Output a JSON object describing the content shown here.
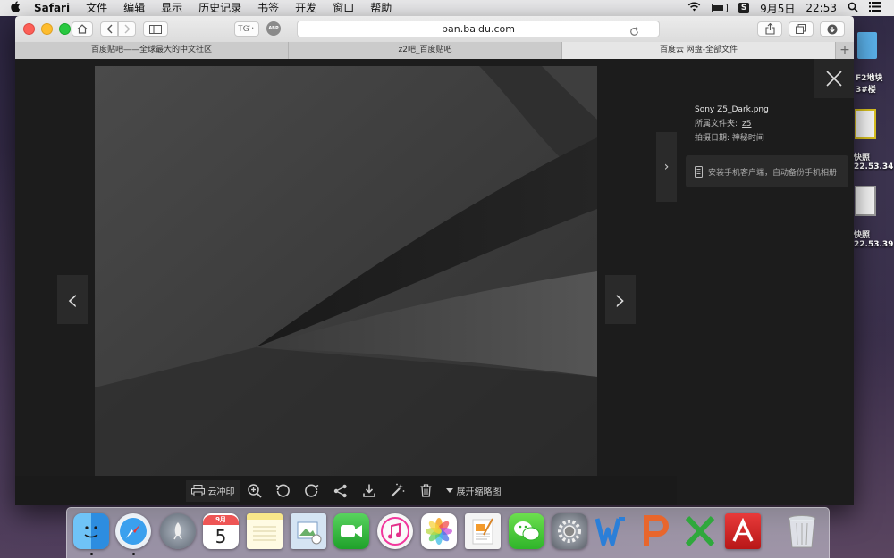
{
  "menubar": {
    "apple": "",
    "items": [
      "Safari",
      "文件",
      "编辑",
      "显示",
      "历史记录",
      "书签",
      "开发",
      "窗口",
      "帮助"
    ],
    "s_badge": "S",
    "date": "9月5日",
    "time": "22:53"
  },
  "desktop_icons": [
    {
      "line1": "F2地块",
      "line2": "3#楼"
    },
    {
      "line1": "快照",
      "line2": "22.53.34"
    },
    {
      "line1": "快照",
      "line2": "22.53.39"
    }
  ],
  "browser": {
    "reader_label": "ᎢᏳ᛫",
    "abp_label": "ABP",
    "url": "pan.baidu.com",
    "tabs": [
      {
        "title": "百度贴吧——全球最大的中文社区"
      },
      {
        "title": "z2吧_百度贴吧"
      },
      {
        "title": "百度云 网盘-全部文件"
      }
    ],
    "new_tab": "+"
  },
  "viewer": {
    "prev": "‹",
    "next": "›",
    "print_label": "云冲印",
    "thumbnails_label": "展开缩略图"
  },
  "sidebar": {
    "file_name": "Sony Z5_Dark.png",
    "folder_label": "所属文件夹:",
    "folder_value": "z5",
    "date_label": "拍摄日期:",
    "date_value": "神秘时间",
    "install_text": "安装手机客户端，自动备份手机相册",
    "expand": "›"
  },
  "dock": {
    "calendar_month": "9月",
    "calendar_day": "5",
    "items": [
      "finder",
      "safari",
      "launchpad",
      "calendar",
      "notes",
      "preview",
      "facetime",
      "itunes",
      "photos",
      "pages",
      "wechat",
      "system-preferences",
      "word",
      "powerpoint",
      "excel",
      "autocad",
      "trash"
    ]
  }
}
